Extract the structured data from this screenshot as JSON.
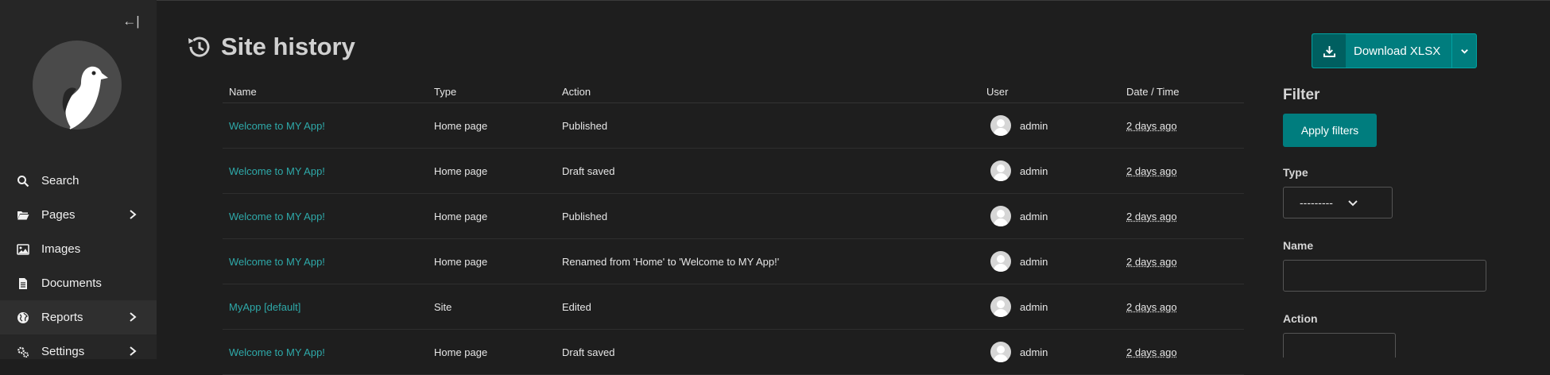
{
  "sidebar": {
    "collapse_symbol": "←|",
    "items": [
      {
        "label": "Search",
        "icon": "search-icon",
        "has_children": false
      },
      {
        "label": "Pages",
        "icon": "folder-icon",
        "has_children": true
      },
      {
        "label": "Images",
        "icon": "image-icon",
        "has_children": false
      },
      {
        "label": "Documents",
        "icon": "document-icon",
        "has_children": false
      },
      {
        "label": "Reports",
        "icon": "globe-icon",
        "has_children": true
      },
      {
        "label": "Settings",
        "icon": "cogs-icon",
        "has_children": true
      }
    ]
  },
  "header": {
    "title": "Site history",
    "icon": "history-icon"
  },
  "download": {
    "label": "Download XLSX",
    "icon": "download-icon"
  },
  "table": {
    "columns": [
      "Name",
      "Type",
      "Action",
      "User",
      "Date / Time"
    ],
    "rows": [
      {
        "name": "Welcome to MY App!",
        "type": "Home page",
        "action": "Published",
        "user": "admin",
        "date": "2 days ago"
      },
      {
        "name": "Welcome to MY App!",
        "type": "Home page",
        "action": "Draft saved",
        "user": "admin",
        "date": "2 days ago"
      },
      {
        "name": "Welcome to MY App!",
        "type": "Home page",
        "action": "Published",
        "user": "admin",
        "date": "2 days ago"
      },
      {
        "name": "Welcome to MY App!",
        "type": "Home page",
        "action": "Renamed from 'Home' to 'Welcome to MY App!'",
        "user": "admin",
        "date": "2 days ago"
      },
      {
        "name": "MyApp [default]",
        "type": "Site",
        "action": "Edited",
        "user": "admin",
        "date": "2 days ago"
      },
      {
        "name": "Welcome to MY App!",
        "type": "Home page",
        "action": "Draft saved",
        "user": "admin",
        "date": "2 days ago"
      }
    ]
  },
  "filter": {
    "title": "Filter",
    "apply_label": "Apply filters",
    "type_label": "Type",
    "type_value": "---------",
    "name_label": "Name",
    "name_value": "",
    "action_label": "Action"
  },
  "colors": {
    "accent": "#007d7e",
    "link": "#2ea9a9",
    "sidebar_bg": "#262626",
    "main_bg": "#1e1e1e"
  }
}
